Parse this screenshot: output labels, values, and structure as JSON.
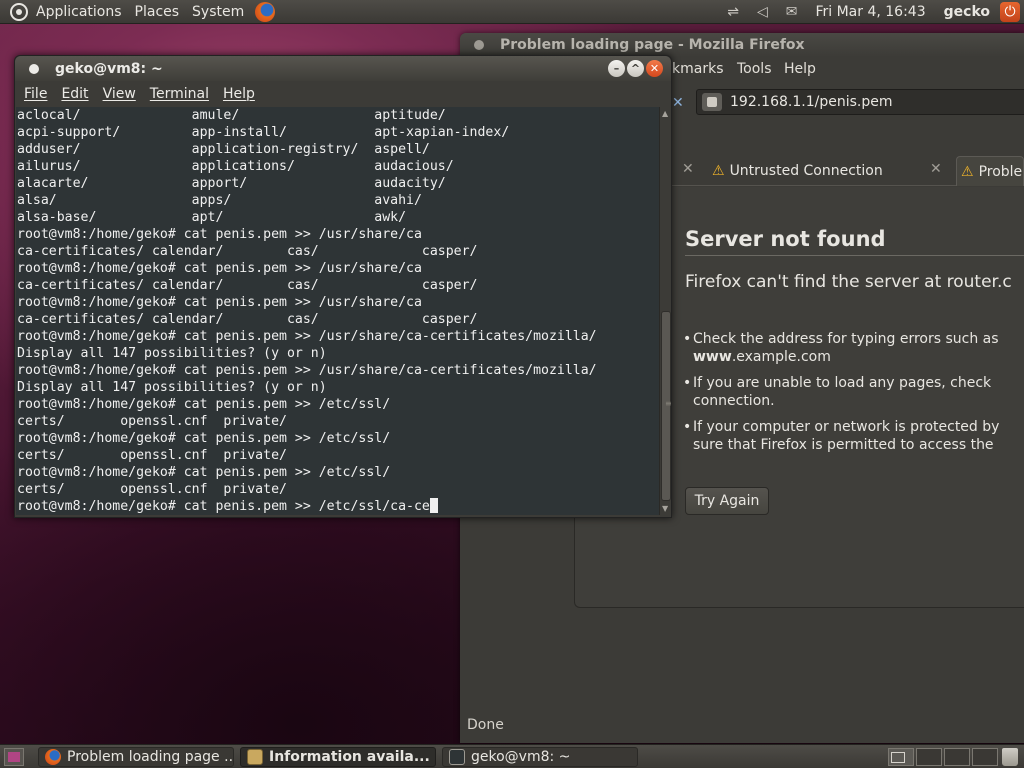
{
  "top_panel": {
    "menus": [
      "Applications",
      "Places",
      "System"
    ],
    "clock": "Fri Mar  4, 16:43",
    "user": "gecko",
    "icons": [
      "ubuntu-logo-icon",
      "firefox-launcher-icon",
      "network-icon",
      "volume-icon",
      "mail-icon",
      "power-icon"
    ]
  },
  "firefox": {
    "title": "Problem loading page - Mozilla Firefox",
    "menu": [
      "kmarks",
      "Tools",
      "Help"
    ],
    "url": "192.168.1.1/penis.pem",
    "tabs": [
      {
        "label": "Untrusted Connection"
      },
      {
        "label": "Proble"
      }
    ],
    "error": {
      "title": "Server not found",
      "subtitle": "Firefox can't find the server at router.c",
      "bullets": [
        {
          "line1": "Check the address for typing errors such as",
          "line2_bold": "www",
          "line2_rest": ".example.com"
        },
        {
          "line1": "If you are unable to load any pages, check",
          "line2": "connection."
        },
        {
          "line1": "If your computer or network is protected by",
          "line2": "sure that Firefox is permitted to access the"
        }
      ],
      "button": "Try Again"
    },
    "status": "Done"
  },
  "terminal": {
    "title": "geko@vm8: ~",
    "menu": [
      "File",
      "Edit",
      "View",
      "Terminal",
      "Help"
    ],
    "lines": [
      "aclocal/              amule/                 aptitude/",
      "acpi-support/         app-install/           apt-xapian-index/",
      "adduser/              application-registry/  aspell/",
      "ailurus/              applications/          audacious/",
      "alacarte/             apport/                audacity/",
      "alsa/                 apps/                  avahi/",
      "alsa-base/            apt/                   awk/",
      "root@vm8:/home/geko# cat penis.pem >> /usr/share/ca",
      "ca-certificates/ calendar/        cas/             casper/",
      "root@vm8:/home/geko# cat penis.pem >> /usr/share/ca",
      "ca-certificates/ calendar/        cas/             casper/",
      "root@vm8:/home/geko# cat penis.pem >> /usr/share/ca",
      "ca-certificates/ calendar/        cas/             casper/",
      "root@vm8:/home/geko# cat penis.pem >> /usr/share/ca-certificates/mozilla/",
      "Display all 147 possibilities? (y or n)",
      "root@vm8:/home/geko# cat penis.pem >> /usr/share/ca-certificates/mozilla/",
      "Display all 147 possibilities? (y or n)",
      "root@vm8:/home/geko# cat penis.pem >> /etc/ssl/",
      "certs/       openssl.cnf  private/",
      "root@vm8:/home/geko# cat penis.pem >> /etc/ssl/",
      "certs/       openssl.cnf  private/",
      "root@vm8:/home/geko# cat penis.pem >> /etc/ssl/",
      "certs/       openssl.cnf  private/"
    ],
    "prompt_line": "root@vm8:/home/geko# cat penis.pem >> /etc/ssl/ca-ce"
  },
  "taskbar": {
    "items": [
      {
        "label": "Problem loading page ...",
        "icon": "firefox-icon"
      },
      {
        "label": "Information availa...",
        "icon": "info-icon"
      },
      {
        "label": "geko@vm8: ~",
        "icon": "terminal-icon"
      }
    ]
  }
}
